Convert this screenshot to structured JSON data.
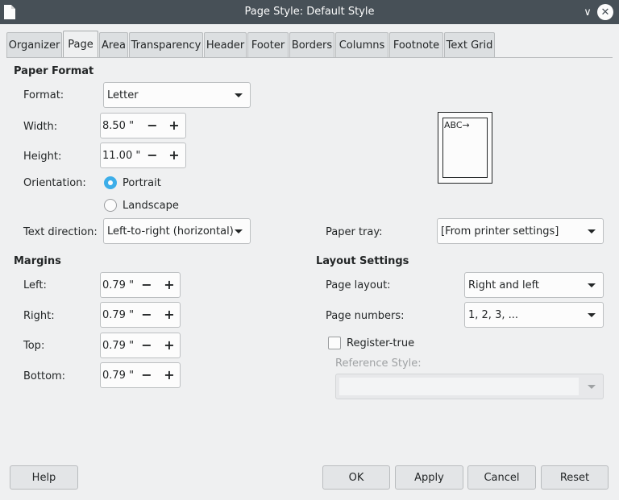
{
  "window": {
    "title": "Page Style: Default Style",
    "minimize_glyph": "∨",
    "close_glyph": "✕"
  },
  "tabs": [
    "Organizer",
    "Page",
    "Area",
    "Transparency",
    "Header",
    "Footer",
    "Borders",
    "Columns",
    "Footnote",
    "Text Grid"
  ],
  "active_tab": "Page",
  "paper_format": {
    "title": "Paper Format",
    "format_label": "Format:",
    "format_value": "Letter",
    "width_label": "Width:",
    "width_value": "8.50 \"",
    "height_label": "Height:",
    "height_value": "11.00 \"",
    "orientation_label": "Orientation:",
    "portrait_label": "Portrait",
    "landscape_label": "Landscape",
    "orientation_selected": "Portrait",
    "text_direction_label": "Text direction:",
    "text_direction_value": "Left-to-right (horizontal)",
    "paper_tray_label": "Paper tray:",
    "paper_tray_value": "[From printer settings]",
    "preview_text": "ABC→"
  },
  "margins": {
    "title": "Margins",
    "left_label": "Left:",
    "left_value": "0.79 \"",
    "right_label": "Right:",
    "right_value": "0.79 \"",
    "top_label": "Top:",
    "top_value": "0.79 \"",
    "bottom_label": "Bottom:",
    "bottom_value": "0.79 \""
  },
  "layout_settings": {
    "title": "Layout Settings",
    "page_layout_label": "Page layout:",
    "page_layout_value": "Right and left",
    "page_numbers_label": "Page numbers:",
    "page_numbers_value": "1, 2, 3, ...",
    "register_true_label": "Register-true",
    "register_true_checked": false,
    "reference_style_label": "Reference Style:",
    "reference_style_value": ""
  },
  "spin": {
    "minus": "−",
    "plus": "+"
  },
  "buttons": {
    "help": "Help",
    "ok": "OK",
    "apply": "Apply",
    "cancel": "Cancel",
    "reset": "Reset"
  },
  "colors": {
    "titlebar": "#475057",
    "accent": "#3daee9",
    "background": "#eff0f1"
  }
}
